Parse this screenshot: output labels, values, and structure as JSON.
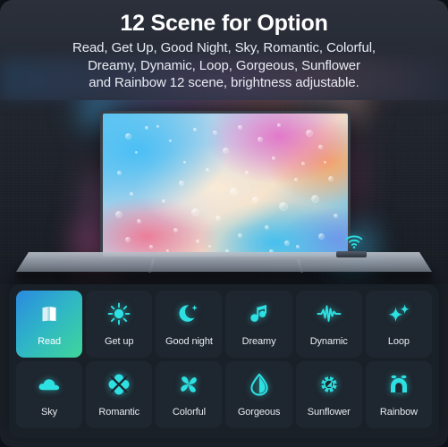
{
  "header": {
    "title": "12 Scene for Option",
    "subtitle_lines": [
      "Read, Get Up, Good Night, Sky, Romantic, Colorful,",
      "Dreamy, Dynamic, Loop, Gorgeous, Sunflower",
      "and Rainbow 12 scene, brightness adjustable."
    ]
  },
  "scene": {
    "device_icon": "wifi-icon",
    "tv_wallpaper": "colorful-bubble-abstract"
  },
  "colors": {
    "panel_bg": "#192028",
    "tile_bg": "#1e262f",
    "accent_cyan": "#2de0e2",
    "active_gradient_start": "#2b8ae0",
    "active_gradient_mid": "#2fb6c6",
    "active_gradient_end": "#3fd69a",
    "text_primary": "#ffffff",
    "text_secondary": "#e7ebf2"
  },
  "scenes": [
    {
      "label": "Read",
      "icon": "book-icon",
      "active": true
    },
    {
      "label": "Get up",
      "icon": "sun-icon",
      "active": false
    },
    {
      "label": "Good night",
      "icon": "moon-icon",
      "active": false
    },
    {
      "label": "Dreamy",
      "icon": "music-note-icon",
      "active": false
    },
    {
      "label": "Dynamic",
      "icon": "waveform-icon",
      "active": false
    },
    {
      "label": "Loop",
      "icon": "sparkles-icon",
      "active": false
    },
    {
      "label": "Sky",
      "icon": "cloud-icon",
      "active": false
    },
    {
      "label": "Romantic",
      "icon": "clover-icon",
      "active": false
    },
    {
      "label": "Colorful",
      "icon": "pinwheel-icon",
      "active": false
    },
    {
      "label": "Gorgeous",
      "icon": "droplet-icon",
      "active": false
    },
    {
      "label": "Sunflower",
      "icon": "flower-gear-icon",
      "active": false
    },
    {
      "label": "Rainbow",
      "icon": "rainbow-arch-icon",
      "active": false
    }
  ]
}
